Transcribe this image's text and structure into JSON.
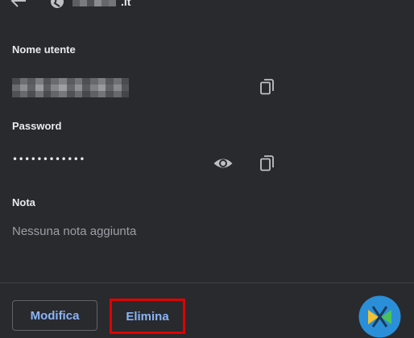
{
  "header": {
    "site_tld": ".it",
    "back_icon": "arrow-back-icon",
    "site_icon": "globe-icon"
  },
  "username": {
    "label": "Nome utente",
    "copy_icon": "copy-icon"
  },
  "password": {
    "label": "Password",
    "masked_value": "••••••••••••",
    "show_icon": "eye-icon",
    "copy_icon": "copy-icon"
  },
  "note": {
    "label": "Nota",
    "value": "Nessuna nota aggiunta"
  },
  "actions": {
    "edit_label": "Modifica",
    "delete_label": "Elimina",
    "delete_highlight_color": "#e00000",
    "accent_color": "#8ab4f8"
  },
  "colors": {
    "background": "#292a2d",
    "text": "#e8eaed",
    "muted_text": "#9aa0a6",
    "divider": "#3c4043"
  }
}
